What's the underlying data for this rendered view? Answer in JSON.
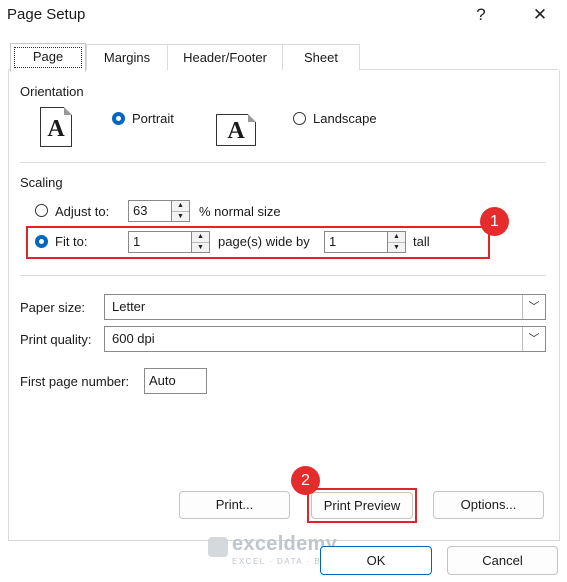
{
  "window": {
    "title": "Page Setup",
    "help_label": "?",
    "close_label": "✕"
  },
  "tabs": [
    {
      "label": "Page"
    },
    {
      "label": "Margins"
    },
    {
      "label": "Header/Footer"
    },
    {
      "label": "Sheet"
    }
  ],
  "orientation": {
    "heading": "Orientation",
    "portrait_label": "Portrait",
    "landscape_label": "Landscape",
    "icon_glyph": "A",
    "selected": "Portrait"
  },
  "scaling": {
    "heading": "Scaling",
    "adjust_to_label": "Adjust to:",
    "adjust_value": "63",
    "adjust_suffix": "% normal size",
    "fit_to_label": "Fit to:",
    "fit_wide_value": "1",
    "fit_wide_suffix": "page(s) wide by",
    "fit_tall_value": "1",
    "fit_tall_suffix": "tall",
    "selected": "Fit to:"
  },
  "paper": {
    "paper_size_label": "Paper size:",
    "paper_size_value": "Letter",
    "print_quality_label": "Print quality:",
    "print_quality_value": "600 dpi",
    "first_page_label": "First page number:",
    "first_page_value": "Auto"
  },
  "buttons": {
    "print": "Print...",
    "print_preview": "Print Preview",
    "options": "Options...",
    "ok": "OK",
    "cancel": "Cancel"
  },
  "callouts": {
    "one": "1",
    "two": "2"
  },
  "watermark": {
    "brand": "exceldemy",
    "tagline": "EXCEL · DATA · BI"
  },
  "colors": {
    "accent": "#0067c0",
    "callout": "#e52b2b"
  }
}
